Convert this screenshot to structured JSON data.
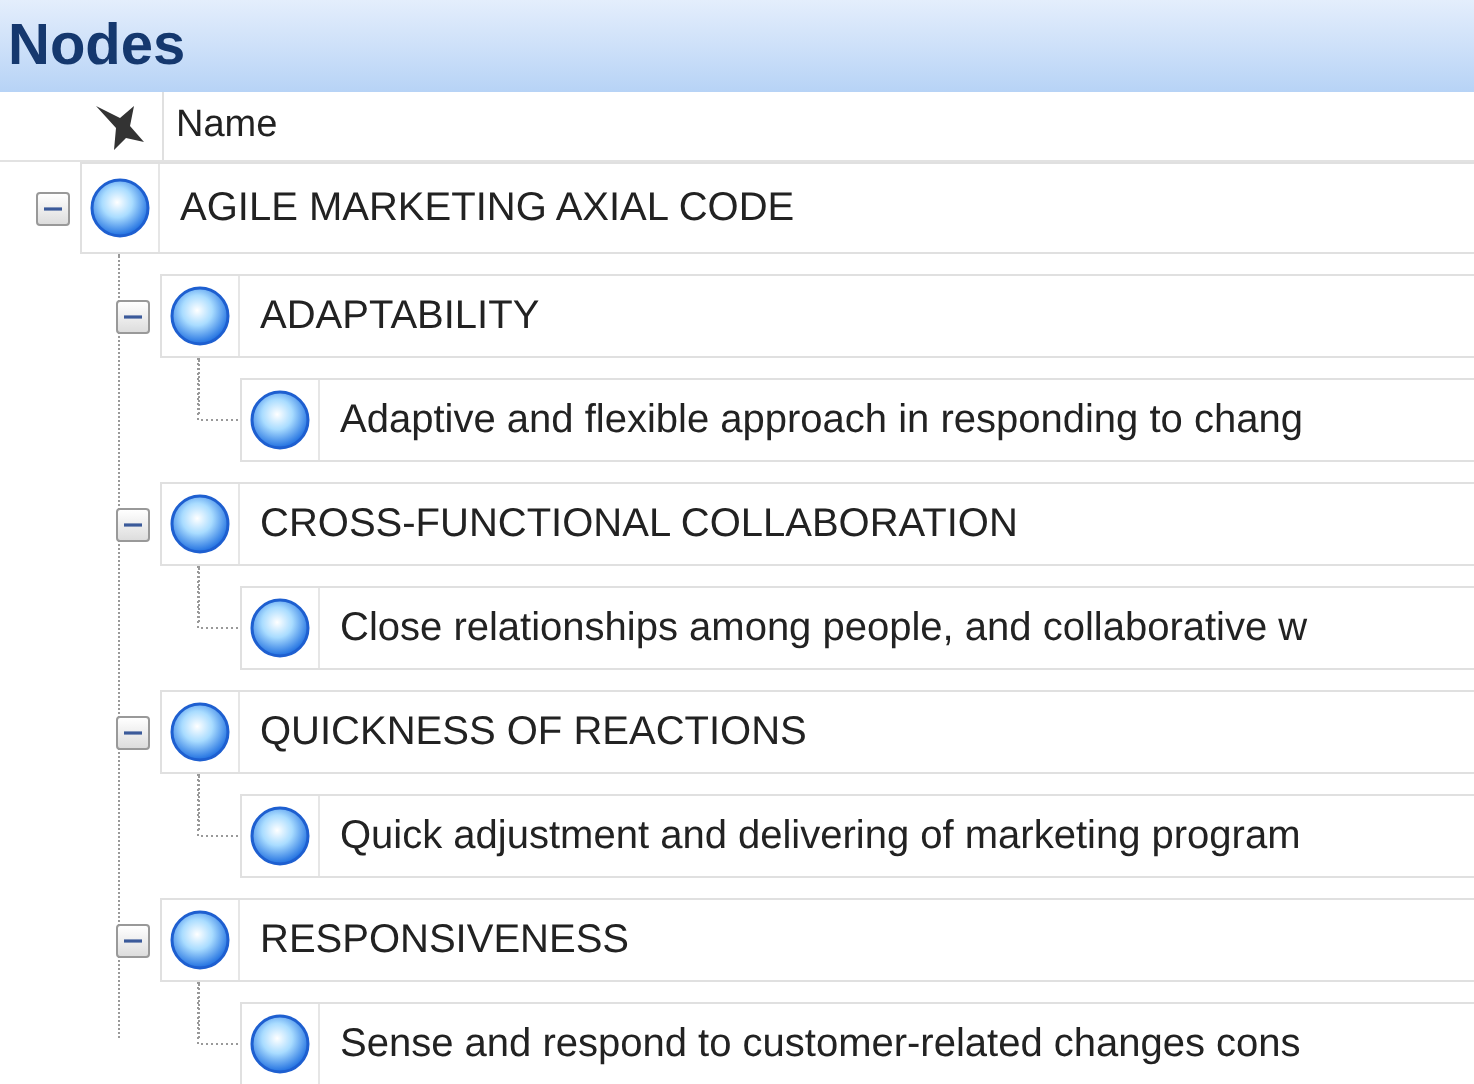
{
  "panel": {
    "title": "Nodes"
  },
  "table": {
    "columns": [
      {
        "label": "Name"
      }
    ]
  },
  "tree": [
    {
      "name": "AGILE MARKETING AXIAL CODE",
      "expanded": true,
      "children": [
        {
          "name": "ADAPTABILITY",
          "expanded": true,
          "children": [
            {
              "name": "Adaptive and flexible approach in responding to chang"
            }
          ]
        },
        {
          "name": "CROSS-FUNCTIONAL COLLABORATION",
          "expanded": true,
          "children": [
            {
              "name": "Close relationships among people, and collaborative w"
            }
          ]
        },
        {
          "name": "QUICKNESS OF REACTIONS",
          "expanded": true,
          "children": [
            {
              "name": "Quick adjustment and delivering of marketing program"
            }
          ]
        },
        {
          "name": "RESPONSIVENESS",
          "expanded": true,
          "children": [
            {
              "name": "Sense and respond to customer-related changes cons"
            }
          ]
        }
      ]
    }
  ]
}
